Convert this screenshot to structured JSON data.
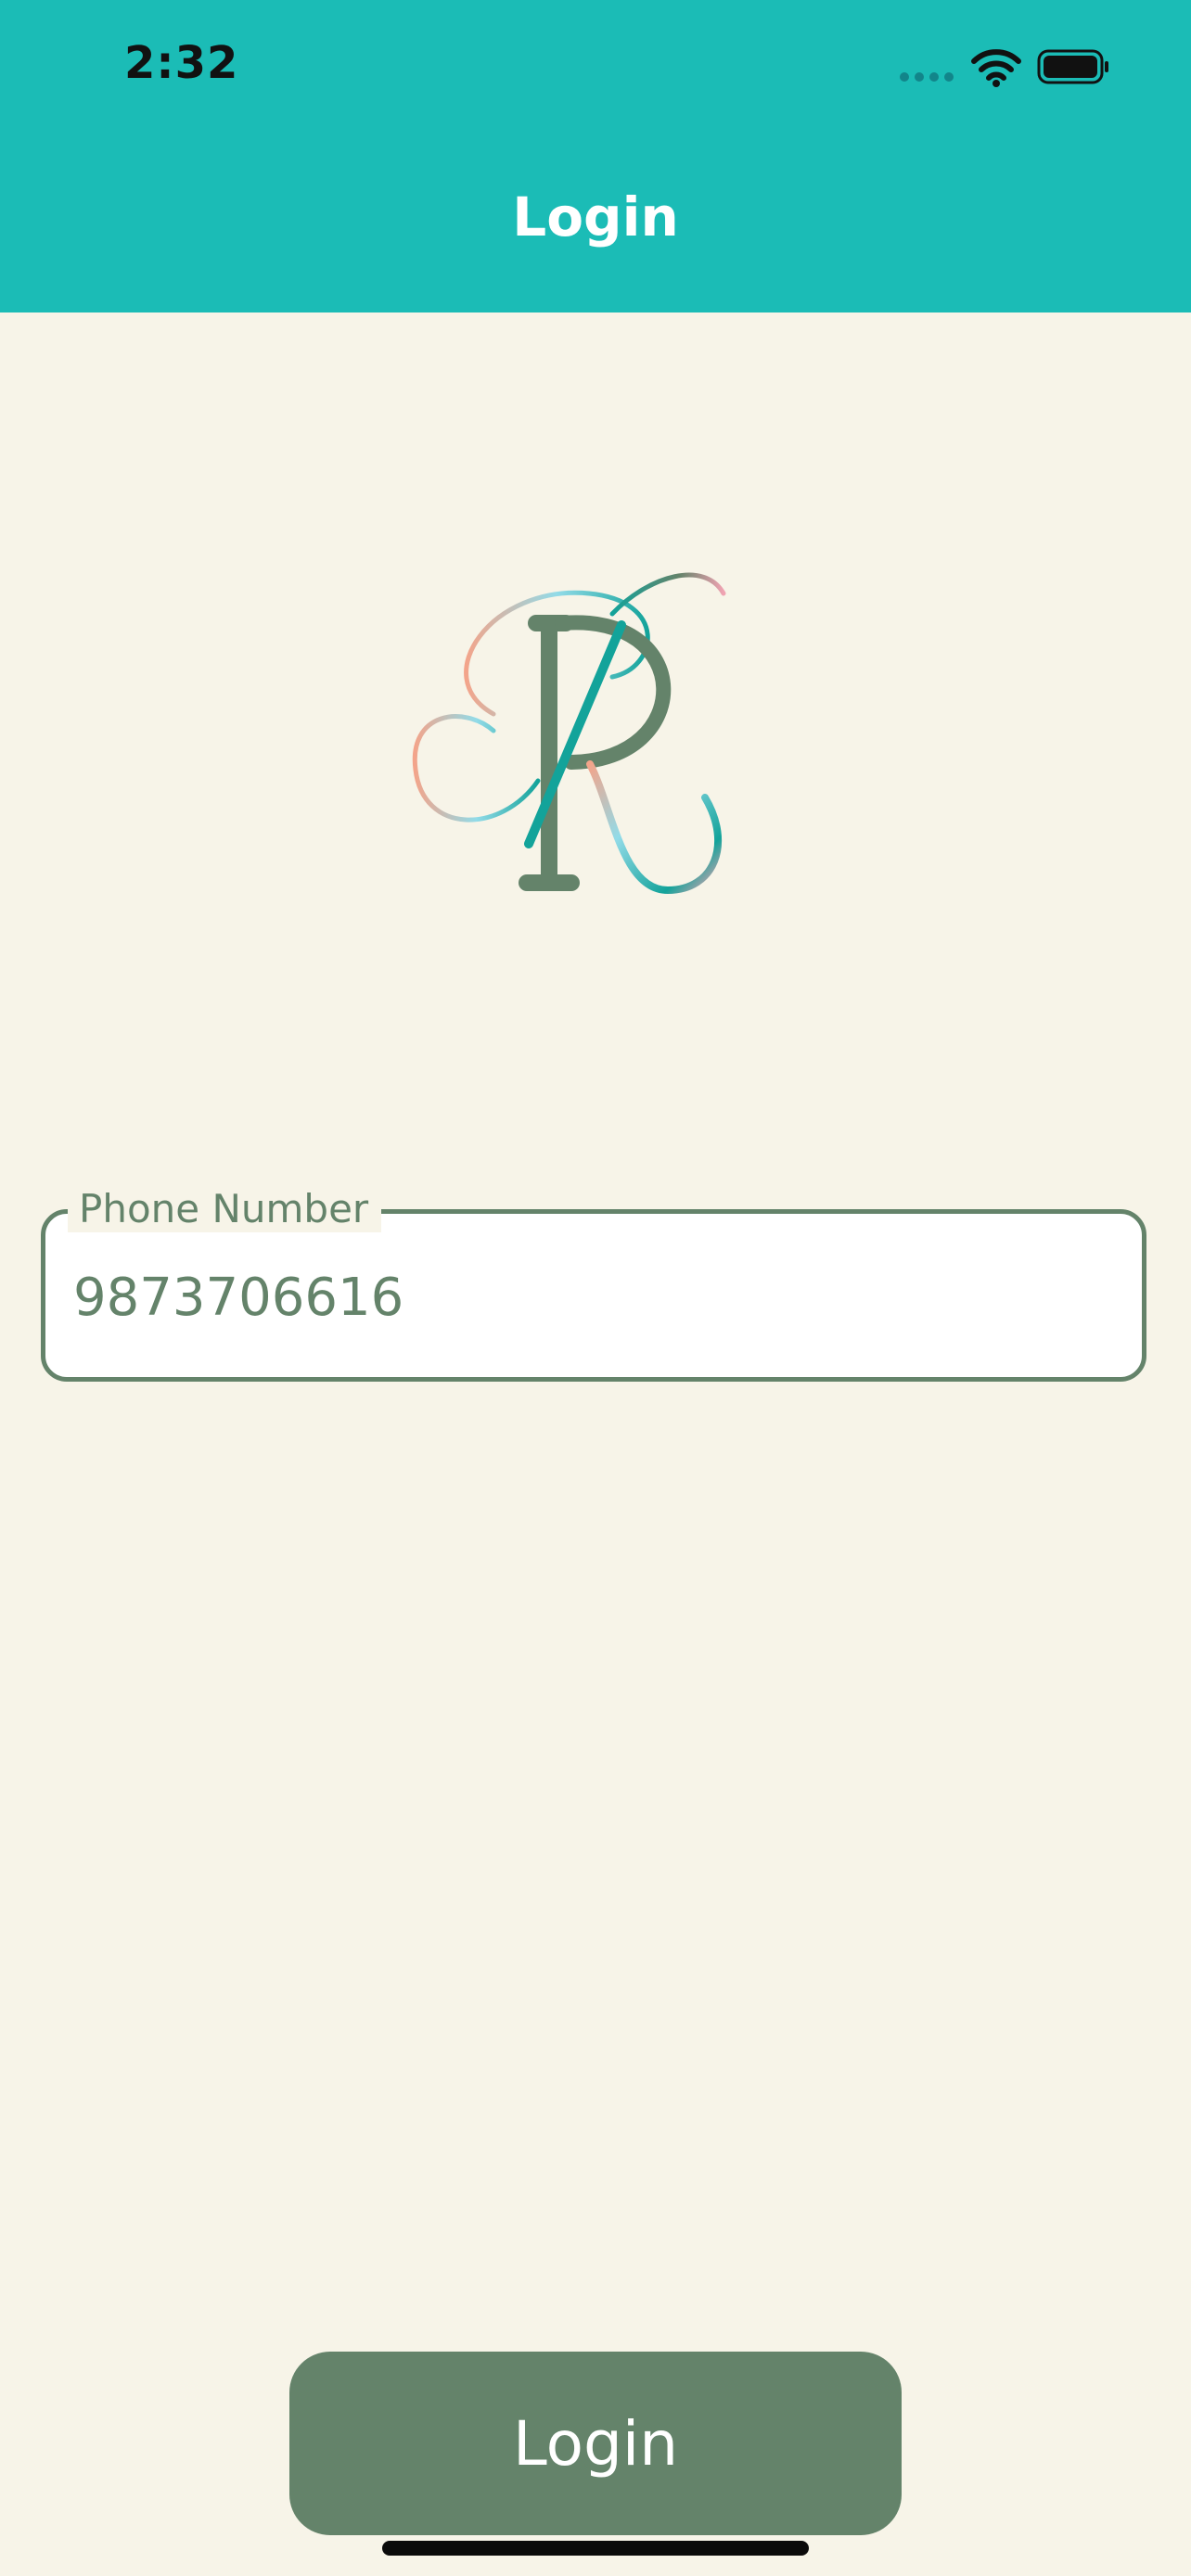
{
  "status_bar": {
    "time": "2:32"
  },
  "header": {
    "title": "Login"
  },
  "logo": {
    "monogram": "PR"
  },
  "phone_field": {
    "label": "Phone Number",
    "value": "9873706616"
  },
  "login_button": {
    "label": "Login"
  },
  "colors": {
    "header": "#1bbcb6",
    "background": "#f7f4e8",
    "accent": "#64836a",
    "white": "#ffffff"
  },
  "icons": [
    "wifi-icon",
    "battery-icon",
    "cellular-signal-icon"
  ]
}
